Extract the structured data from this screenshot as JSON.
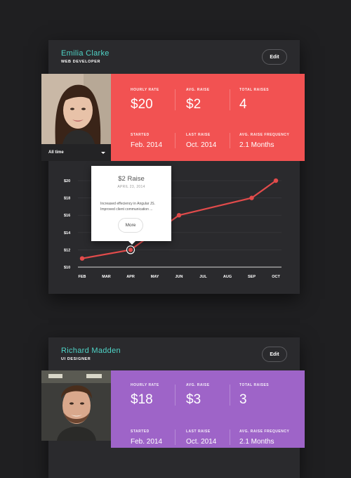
{
  "cards": [
    {
      "name": "Emilia Clarke",
      "role": "WEB DEVELOPER",
      "edit_label": "Edit",
      "accent": "#f25252",
      "stats": {
        "hourly_rate": {
          "label": "HOURLY RATE",
          "value": "$20"
        },
        "avg_raise": {
          "label": "AVG. RAISE",
          "value": "$2"
        },
        "total_raises": {
          "label": "TOTAL RAISES",
          "value": "4"
        },
        "started": {
          "label": "STARTED",
          "value": "Feb. 2014"
        },
        "last_raise": {
          "label": "LAST RAISE",
          "value": "Oct. 2014"
        },
        "avg_raise_frequency": {
          "label": "AVG. RAISE FREQUENCY",
          "value": "2.1 Months"
        }
      },
      "period_select": "All time",
      "tooltip": {
        "title": "$2 Raise",
        "date": "APRIL 23, 2014",
        "description": "Increased effeciency in Angular JS. Improved client communication ...",
        "more_label": "More"
      }
    },
    {
      "name": "Richard Madden",
      "role": "UI DESIGNER",
      "edit_label": "Edit",
      "accent": "#9e64c8",
      "stats": {
        "hourly_rate": {
          "label": "HOURLY RATE",
          "value": "$18"
        },
        "avg_raise": {
          "label": "AVG. RAISE",
          "value": "$3"
        },
        "total_raises": {
          "label": "TOTAL RAISES",
          "value": "3"
        },
        "started": {
          "label": "STARTED",
          "value": "Feb. 2014"
        },
        "last_raise": {
          "label": "LAST RAISE",
          "value": "Oct. 2014"
        },
        "avg_raise_frequency": {
          "label": "AVG. RAISE FREQUENCY",
          "value": "2.1 Months"
        }
      }
    }
  ],
  "chart_data": {
    "type": "line",
    "categories": [
      "FEB",
      "MAR",
      "APR",
      "MAY",
      "JUN",
      "JUL",
      "AUG",
      "SEP",
      "OCT"
    ],
    "y_ticks": [
      "$20",
      "$18",
      "$16",
      "$14",
      "$12",
      "$10"
    ],
    "ylim": [
      10,
      20
    ],
    "grid": true,
    "series": [
      {
        "points": [
          {
            "x": "FEB",
            "y": 11
          },
          {
            "x": "APR",
            "y": 12
          },
          {
            "x": "JUN",
            "y": 16
          },
          {
            "x": "SEP",
            "y": 18
          },
          {
            "x": "OCT",
            "y": 20
          }
        ],
        "color": "#e24b4b"
      }
    ],
    "highlighted_point": "APR"
  }
}
